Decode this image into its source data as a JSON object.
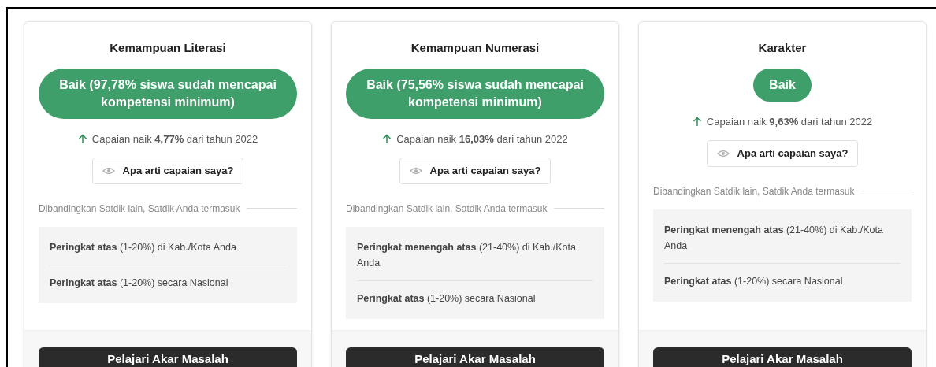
{
  "cards": [
    {
      "title": "Kemampuan Literasi",
      "status": "Baik (97,78% siswa sudah mencapai kompetensi minimum)",
      "change": "Capaian naik **4,77%** dari tahun 2022",
      "help_button": "Apa arti capaian saya?",
      "comparison_label": "Dibandingkan Satdik lain, Satdik Anda termasuk",
      "ranks": [
        "**Peringkat atas** (1-20%) di Kab./Kota Anda",
        "**Peringkat atas** (1-20%) secara Nasional"
      ],
      "action_button": "Pelajari Akar Masalah"
    },
    {
      "title": "Kemampuan Numerasi",
      "status": "Baik (75,56% siswa sudah mencapai kompetensi minimum)",
      "change": "Capaian naik **16,03%** dari tahun 2022",
      "help_button": "Apa arti capaian saya?",
      "comparison_label": "Dibandingkan Satdik lain, Satdik Anda termasuk",
      "ranks": [
        "**Peringkat menengah atas** (21-40%) di Kab./Kota Anda",
        "**Peringkat atas** (1-20%) secara Nasional"
      ],
      "action_button": "Pelajari Akar Masalah"
    },
    {
      "title": "Karakter",
      "status": "Baik",
      "change": "Capaian naik **9,63%** dari tahun 2022",
      "help_button": "Apa arti capaian saya?",
      "comparison_label": "Dibandingkan Satdik lain, Satdik Anda termasuk",
      "ranks": [
        "**Peringkat menengah atas** (21-40%) di Kab./Kota Anda",
        "**Peringkat atas** (1-20%) secara Nasional"
      ],
      "action_button": "Pelajari Akar Masalah"
    }
  ]
}
